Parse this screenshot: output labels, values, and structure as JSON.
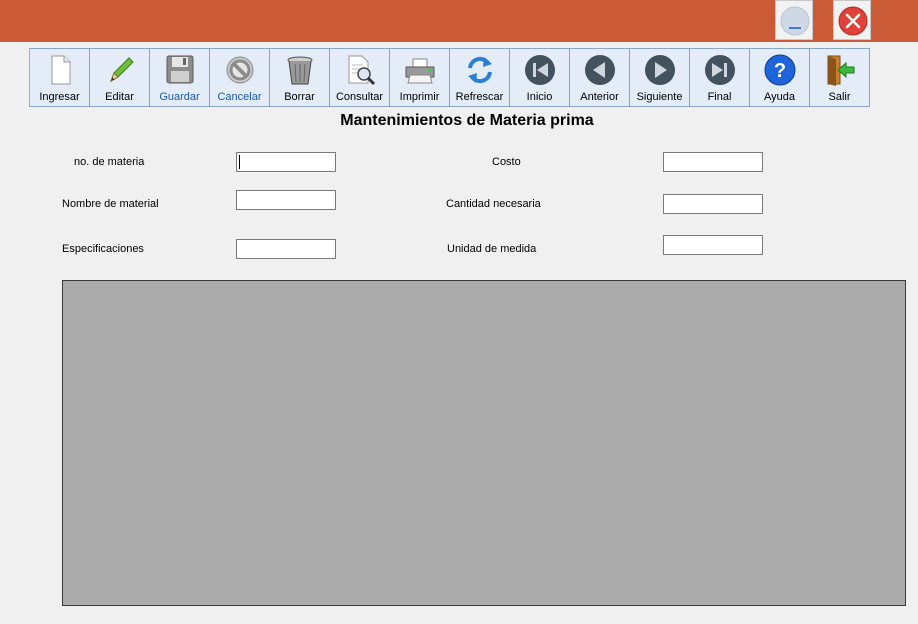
{
  "title_bar": {
    "color": "#cb5b37"
  },
  "window_controls": {
    "minimize_icon": "minimize-icon",
    "close_icon": "close-icon"
  },
  "toolbar": {
    "buttons": [
      {
        "label": "Ingresar",
        "icon": "new-document-icon"
      },
      {
        "label": "Editar",
        "icon": "pencil-icon"
      },
      {
        "label": "Guardar",
        "icon": "floppy-disk-icon",
        "enabled": false
      },
      {
        "label": "Cancelar",
        "icon": "cancel-icon",
        "enabled": false
      },
      {
        "label": "Borrar",
        "icon": "trash-icon"
      },
      {
        "label": "Consultar",
        "icon": "search-document-icon"
      },
      {
        "label": "Imprimir",
        "icon": "printer-icon"
      },
      {
        "label": "Refrescar",
        "icon": "refresh-icon"
      },
      {
        "label": "Inicio",
        "icon": "first-record-icon"
      },
      {
        "label": "Anterior",
        "icon": "previous-record-icon"
      },
      {
        "label": "Siguiente",
        "icon": "next-record-icon"
      },
      {
        "label": "Final",
        "icon": "last-record-icon"
      },
      {
        "label": "Ayuda",
        "icon": "help-icon"
      },
      {
        "label": "Salir",
        "icon": "exit-door-icon"
      }
    ]
  },
  "form": {
    "title": "Mantenimientos de Materia prima",
    "fields": {
      "no_materia": {
        "label": "no. de materia",
        "value": ""
      },
      "nombre": {
        "label": "Nombre de material",
        "value": ""
      },
      "especificaciones": {
        "label": "Especificaciones",
        "value": ""
      },
      "costo": {
        "label": "Costo",
        "value": ""
      },
      "cantidad": {
        "label": "Cantidad necesaria",
        "value": ""
      },
      "unidad": {
        "label": "Unidad de medida",
        "value": ""
      }
    }
  },
  "grid": {
    "background": "#ababab"
  }
}
